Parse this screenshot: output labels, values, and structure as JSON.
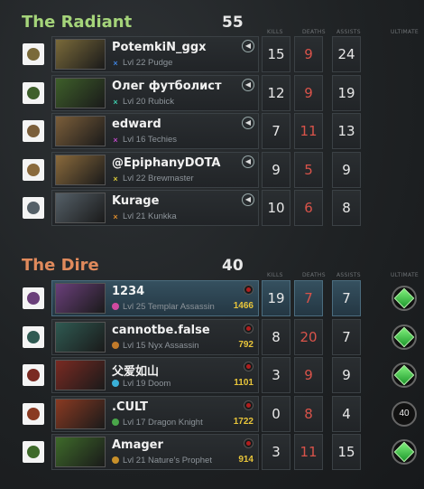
{
  "radiant": {
    "name": "The Radiant",
    "score": "55",
    "color": "#a5d47a",
    "columns": {
      "kills": "KILLS",
      "deaths": "DEATHS",
      "assists": "ASSISTS",
      "ultimate": "ULTIMATE"
    },
    "players": [
      {
        "name": "PotemkiN_ggx",
        "level": "Lvl 22 Pudge",
        "attr": "×",
        "attr_color": "#3e7fd8",
        "kills": "15",
        "deaths": "9",
        "assists": "24",
        "hero_color": "#7a6a3a"
      },
      {
        "name": "Олег футболист",
        "level": "Lvl 20 Rubick",
        "attr": "×",
        "attr_color": "#3dc7a8",
        "kills": "12",
        "deaths": "9",
        "assists": "19",
        "hero_color": "#3e5f2a"
      },
      {
        "name": "edward",
        "level": "Lvl 16 Techies",
        "attr": "×",
        "attr_color": "#b848c0",
        "kills": "7",
        "deaths": "11",
        "assists": "13",
        "hero_color": "#7b5e3a"
      },
      {
        "name": "@EpiphanyDOTA",
        "level": "Lvl 22 Brewmaster",
        "attr": "×",
        "attr_color": "#d4c43a",
        "kills": "9",
        "deaths": "5",
        "assists": "9",
        "hero_color": "#8a6a3c"
      },
      {
        "name": "Kurage",
        "level": "Lvl 21 Kunkka",
        "attr": "×",
        "attr_color": "#d88a2c",
        "kills": "10",
        "deaths": "6",
        "assists": "8",
        "hero_color": "#556068"
      }
    ]
  },
  "dire": {
    "name": "The Dire",
    "score": "40",
    "color": "#e08a5c",
    "columns": {
      "kills": "KILLS",
      "deaths": "DEATHS",
      "assists": "ASSISTS",
      "ultimate": "ULTIMATE"
    },
    "players": [
      {
        "name": "1234",
        "level": "Lvl 25 Templar Assassin",
        "gold": "1466",
        "dot_color": "#d04aa0",
        "kills": "19",
        "deaths": "7",
        "assists": "7",
        "ultimate": "ready",
        "highlight": true,
        "hero_color": "#6a3f7a"
      },
      {
        "name": "cannotbe.false",
        "level": "Lvl 15 Nyx Assassin",
        "gold": "792",
        "dot_color": "#c07a2a",
        "kills": "8",
        "deaths": "20",
        "assists": "7",
        "ultimate": "ready",
        "hero_color": "#2f5a52"
      },
      {
        "name": "父爱如山",
        "level": "Lvl 19 Doom",
        "gold": "1101",
        "dot_color": "#3ab0d8",
        "kills": "3",
        "deaths": "9",
        "assists": "9",
        "ultimate": "ready",
        "hero_color": "#7a2a22"
      },
      {
        "name": ".CULT",
        "level": "Lvl 17 Dragon Knight",
        "gold": "1722",
        "dot_color": "#4aa64a",
        "kills": "0",
        "deaths": "8",
        "assists": "4",
        "ultimate": "40",
        "hero_color": "#8a3a22"
      },
      {
        "name": "Amager",
        "level": "Lvl 21 Nature's Prophet",
        "gold": "914",
        "dot_color": "#c8902a",
        "kills": "3",
        "deaths": "11",
        "assists": "15",
        "ultimate": "ready",
        "hero_color": "#3e6a2a"
      }
    ]
  }
}
